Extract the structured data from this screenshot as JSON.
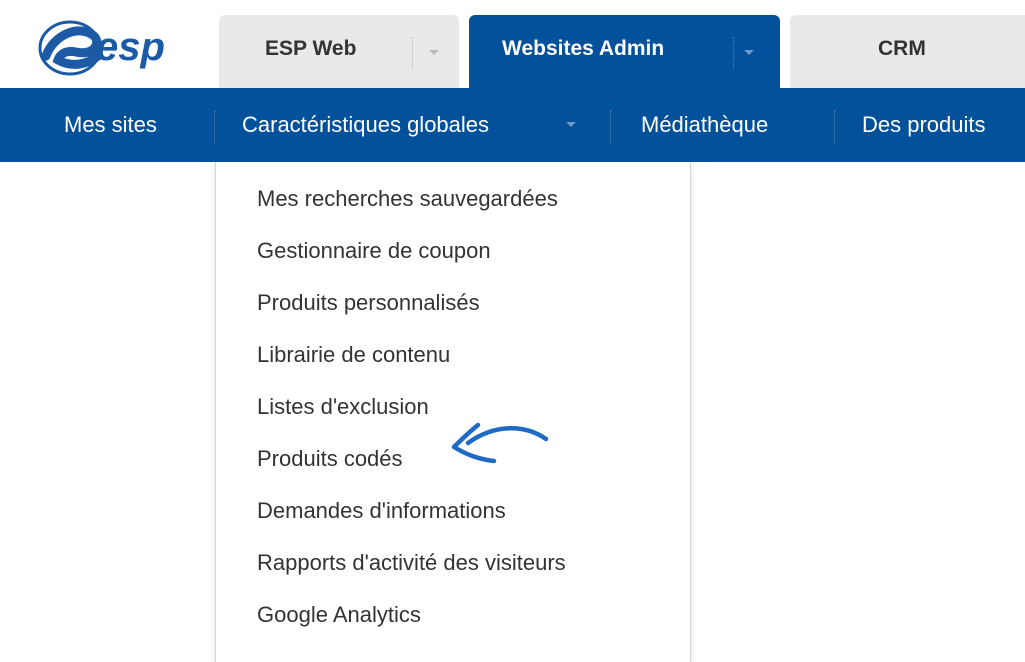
{
  "logo": {
    "text": "esp",
    "mark_color": "#1c5aa6"
  },
  "tabs": [
    {
      "label": "ESP Web",
      "active": false
    },
    {
      "label": "Websites Admin",
      "active": true
    },
    {
      "label": "CRM",
      "active": false
    }
  ],
  "nav": {
    "items": [
      {
        "label": "Mes sites"
      },
      {
        "label": "Caractéristiques globales",
        "has_dropdown": true,
        "open": true
      },
      {
        "label": "Médiathèque"
      },
      {
        "label": "Des produits"
      }
    ]
  },
  "dropdown": {
    "items": [
      {
        "label": "Mes recherches sauvegardées"
      },
      {
        "label": "Gestionnaire de coupon"
      },
      {
        "label": "Produits personnalisés"
      },
      {
        "label": "Librairie de contenu"
      },
      {
        "label": "Listes d'exclusion"
      },
      {
        "label": "Produits codés"
      },
      {
        "label": "Demandes d'informations"
      },
      {
        "label": "Rapports d'activité des visiteurs"
      },
      {
        "label": "Google Analytics"
      }
    ]
  },
  "annotation": {
    "icon": "hand-drawn-arrow-icon",
    "points_to": "Produits codés",
    "color": "#1f6ac3"
  },
  "colors": {
    "primary": "#03519a",
    "tab_inactive": "#e9e9e9",
    "menu_text": "#333333"
  }
}
